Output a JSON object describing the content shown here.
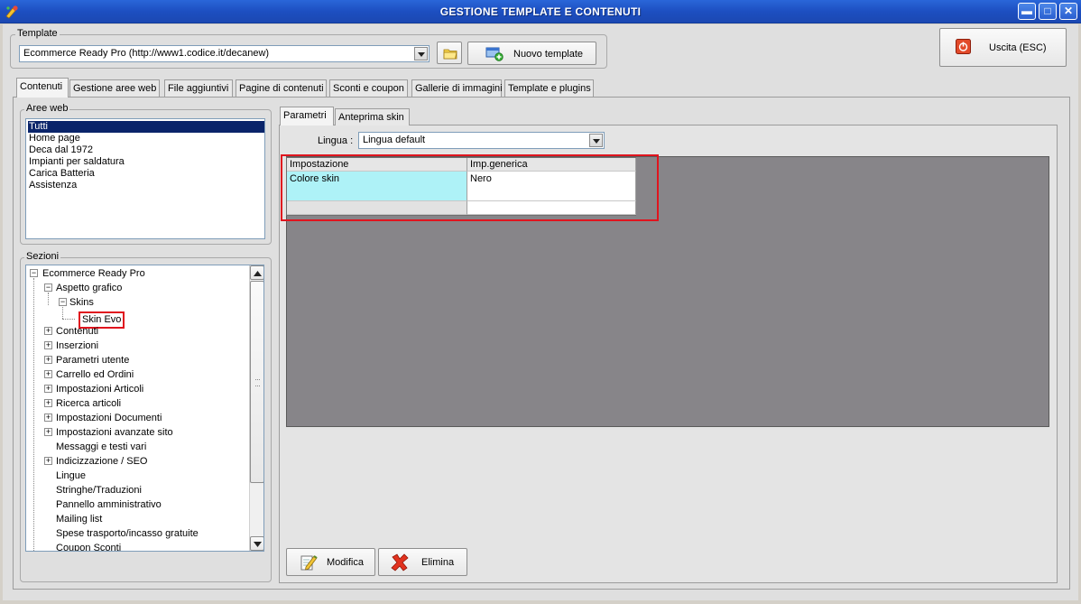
{
  "window": {
    "title": "GESTIONE TEMPLATE E CONTENUTI",
    "minimize": "▬",
    "maximize": "□",
    "close": "✕"
  },
  "template_group": {
    "label": "Template",
    "selected": "Ecommerce Ready Pro (http://www1.codice.it/decanew)",
    "new_button": "Nuovo template"
  },
  "exit_button": "Uscita (ESC)",
  "tabs": [
    {
      "label": "Contenuti",
      "active": true
    },
    {
      "label": "Gestione aree web",
      "active": false
    },
    {
      "label": "File aggiuntivi",
      "active": false
    },
    {
      "label": "Pagine di contenuti",
      "active": false
    },
    {
      "label": "Sconti e coupon",
      "active": false
    },
    {
      "label": "Gallerie di immagini",
      "active": false
    },
    {
      "label": "Template e plugins",
      "active": false
    }
  ],
  "aree_web": {
    "label": "Aree web",
    "items": [
      "Tutti",
      "Home page",
      "Deca dal 1972",
      "Impianti per saldatura",
      "Carica Batteria",
      "Assistenza"
    ],
    "selected_index": 0
  },
  "sezioni": {
    "label": "Sezioni",
    "nodes": [
      {
        "label": "Ecommerce Ready Pro",
        "level": 0,
        "expander": "−"
      },
      {
        "label": "Aspetto grafico",
        "level": 1,
        "expander": "−"
      },
      {
        "label": "Skins",
        "level": 2,
        "expander": "−"
      },
      {
        "label": "Skin Evo",
        "level": 3,
        "expander": ""
      },
      {
        "label": "Contenuti",
        "level": 1,
        "expander": "+"
      },
      {
        "label": "Inserzioni",
        "level": 1,
        "expander": "+"
      },
      {
        "label": "Parametri utente",
        "level": 1,
        "expander": "+"
      },
      {
        "label": "Carrello ed Ordini",
        "level": 1,
        "expander": "+"
      },
      {
        "label": "Impostazioni Articoli",
        "level": 1,
        "expander": "+"
      },
      {
        "label": "Ricerca articoli",
        "level": 1,
        "expander": "+"
      },
      {
        "label": "Impostazioni Documenti",
        "level": 1,
        "expander": "+"
      },
      {
        "label": "Impostazioni avanzate sito",
        "level": 1,
        "expander": "+"
      },
      {
        "label": "Messaggi e testi vari",
        "level": 1,
        "expander": ""
      },
      {
        "label": "Indicizzazione / SEO",
        "level": 1,
        "expander": "+"
      },
      {
        "label": "Lingue",
        "level": 1,
        "expander": ""
      },
      {
        "label": "Stringhe/Traduzioni",
        "level": 1,
        "expander": ""
      },
      {
        "label": "Pannello amministrativo",
        "level": 1,
        "expander": ""
      },
      {
        "label": "Mailing list",
        "level": 1,
        "expander": ""
      },
      {
        "label": "Spese trasporto/incasso gratuite",
        "level": 1,
        "expander": ""
      },
      {
        "label": "Coupon Sconti",
        "level": 1,
        "expander": ""
      }
    ]
  },
  "sub_tabs": [
    {
      "label": "Parametri",
      "active": true
    },
    {
      "label": "Anteprima skin",
      "active": false
    }
  ],
  "lingua": {
    "label": "Lingua :",
    "selected": "Lingua default"
  },
  "grid": {
    "headers": [
      "Impostazione",
      "Imp.generica"
    ],
    "rows": [
      [
        "Colore skin",
        "Nero"
      ]
    ]
  },
  "actions": {
    "modifica": "Modifica",
    "elimina": "Elimina"
  },
  "colors": {
    "highlight_red": "#e0141e",
    "selected_row": "#aef2f7",
    "grid_background": "#878589",
    "title_blue": "#1d4fc1"
  }
}
